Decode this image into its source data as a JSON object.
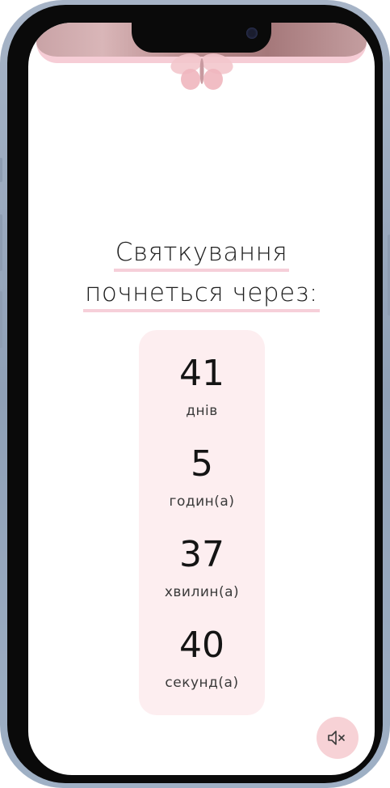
{
  "countdown": {
    "title_line1": "Святкування",
    "title_line2": "почнеться через:",
    "items": [
      {
        "value": "41",
        "unit": "днів"
      },
      {
        "value": "5",
        "unit": "годин(а)"
      },
      {
        "value": "37",
        "unit": "хвилин(а)"
      },
      {
        "value": "40",
        "unit": "секунд(а)"
      }
    ]
  },
  "controls": {
    "mute_icon": "speaker-muted-icon"
  },
  "colors": {
    "accent_pink": "#f6cfd9",
    "card_bg": "#fdeef0",
    "button_bg": "#f7d2d6"
  }
}
